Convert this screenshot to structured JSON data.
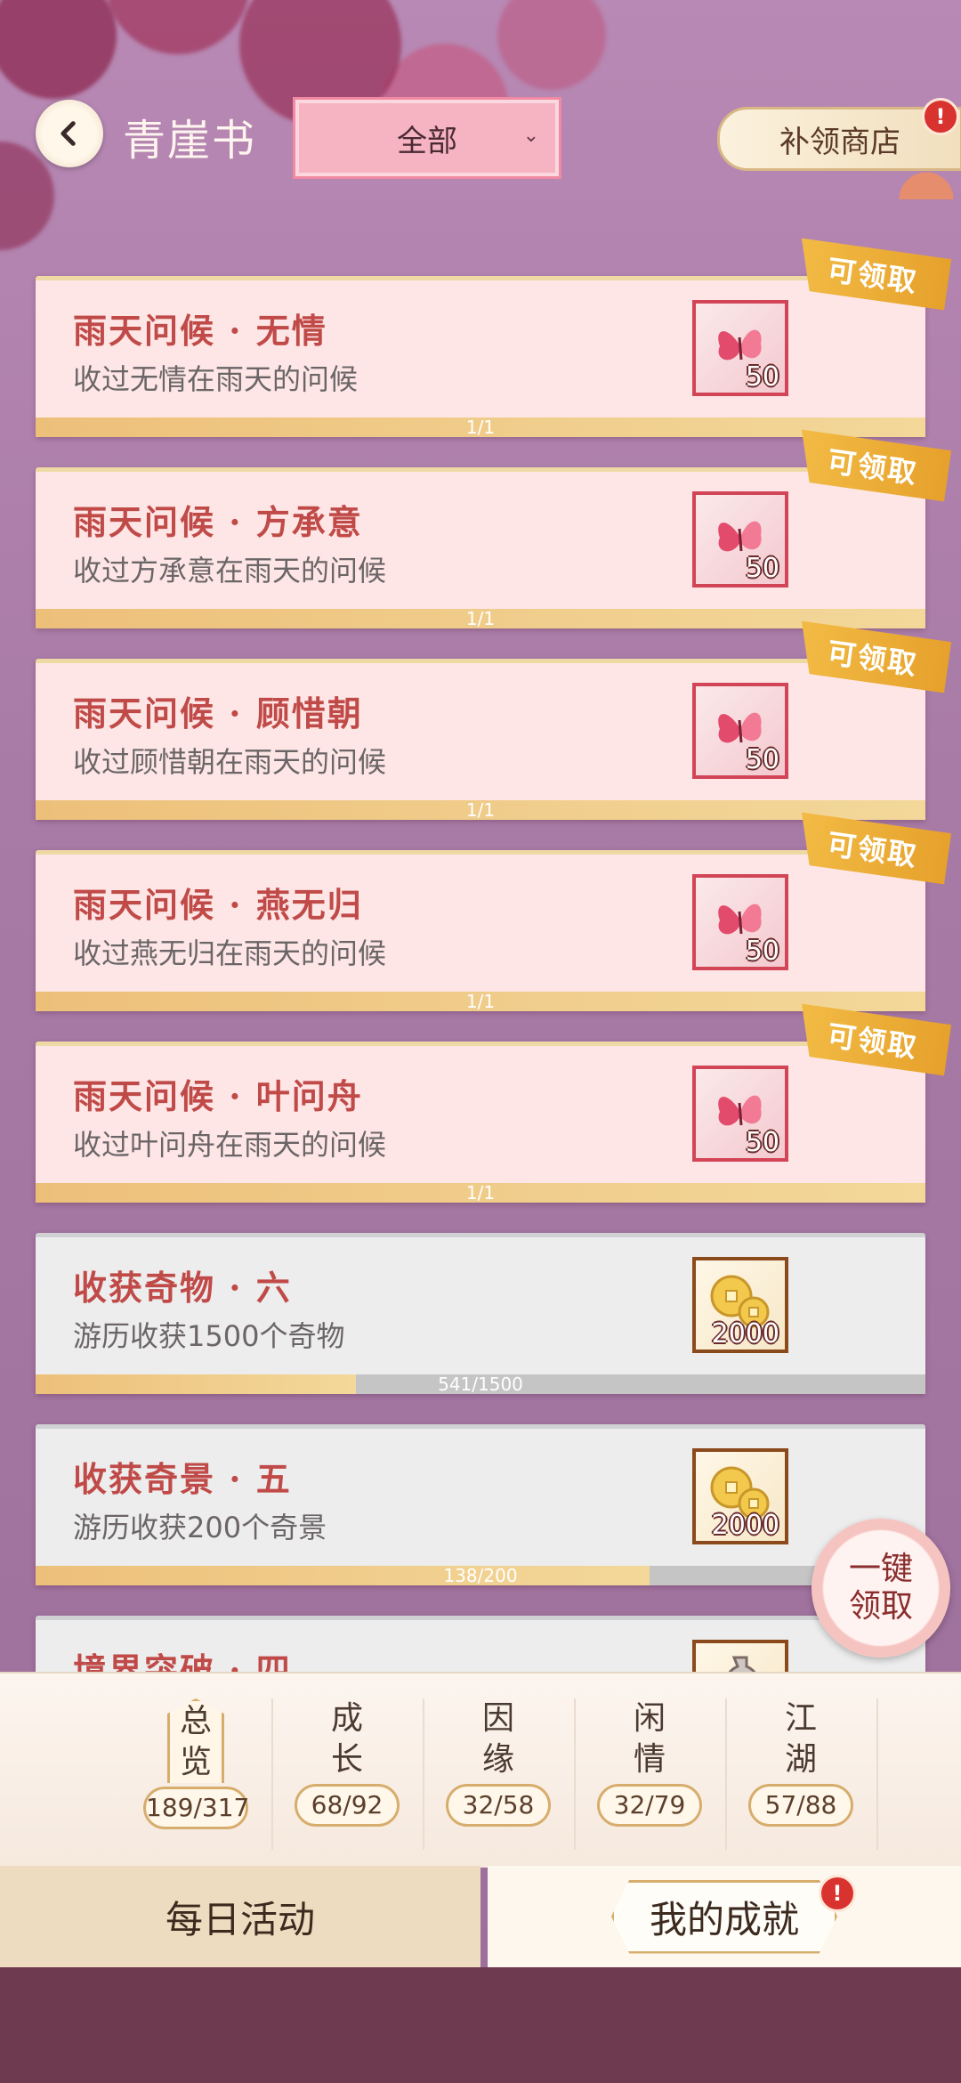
{
  "header": {
    "title": "青崖书",
    "filter_value": "全部",
    "shop_label": "补领商店",
    "shop_alert": "!"
  },
  "achievements": [
    {
      "title": "雨天问候 · 无情",
      "desc": "收过无情在雨天的问候",
      "reward_icon": "butterfly-icon",
      "reward_amount": "50",
      "progress_text": "1/1",
      "progress": 1.0,
      "claimable": true,
      "claim_label": "可领取"
    },
    {
      "title": "雨天问候 · 方承意",
      "desc": "收过方承意在雨天的问候",
      "reward_icon": "butterfly-icon",
      "reward_amount": "50",
      "progress_text": "1/1",
      "progress": 1.0,
      "claimable": true,
      "claim_label": "可领取"
    },
    {
      "title": "雨天问候 · 顾惜朝",
      "desc": "收过顾惜朝在雨天的问候",
      "reward_icon": "butterfly-icon",
      "reward_amount": "50",
      "progress_text": "1/1",
      "progress": 1.0,
      "claimable": true,
      "claim_label": "可领取"
    },
    {
      "title": "雨天问候 · 燕无归",
      "desc": "收过燕无归在雨天的问候",
      "reward_icon": "butterfly-icon",
      "reward_amount": "50",
      "progress_text": "1/1",
      "progress": 1.0,
      "claimable": true,
      "claim_label": "可领取"
    },
    {
      "title": "雨天问候 · 叶问舟",
      "desc": "收过叶问舟在雨天的问候",
      "reward_icon": "butterfly-icon",
      "reward_amount": "50",
      "progress_text": "1/1",
      "progress": 1.0,
      "claimable": true,
      "claim_label": "可领取"
    },
    {
      "title": "收获奇物 · 六",
      "desc": "游历收获1500个奇物",
      "reward_icon": "coin-icon",
      "reward_amount": "2000",
      "progress_text": "541/1500",
      "progress": 0.36,
      "claimable": false,
      "claim_label": ""
    },
    {
      "title": "收获奇景 · 五",
      "desc": "游历收获200个奇景",
      "reward_icon": "coin-icon",
      "reward_amount": "2000",
      "progress_text": "138/200",
      "progress": 0.69,
      "claimable": false,
      "claim_label": ""
    },
    {
      "title": "境界突破 · 四",
      "desc": "",
      "reward_icon": "vase-icon",
      "reward_amount": "",
      "progress_text": "",
      "progress": 0,
      "claimable": false,
      "claim_label": ""
    }
  ],
  "oneclick_label": "一键领取",
  "tabs": [
    {
      "label": "总览",
      "count": "189/317",
      "active": true
    },
    {
      "label": "成长",
      "count": "68/92",
      "active": false
    },
    {
      "label": "因缘",
      "count": "32/58",
      "active": false
    },
    {
      "label": "闲情",
      "count": "32/79",
      "active": false
    },
    {
      "label": "江湖",
      "count": "57/88",
      "active": false
    }
  ],
  "bottom_nav": {
    "daily_label": "每日活动",
    "achievements_label": "我的成就",
    "alert": "!"
  },
  "colors": {
    "title_red": "#c04a48",
    "claim_gold": "#e6a12b",
    "progress_gold": "#edc07a"
  }
}
